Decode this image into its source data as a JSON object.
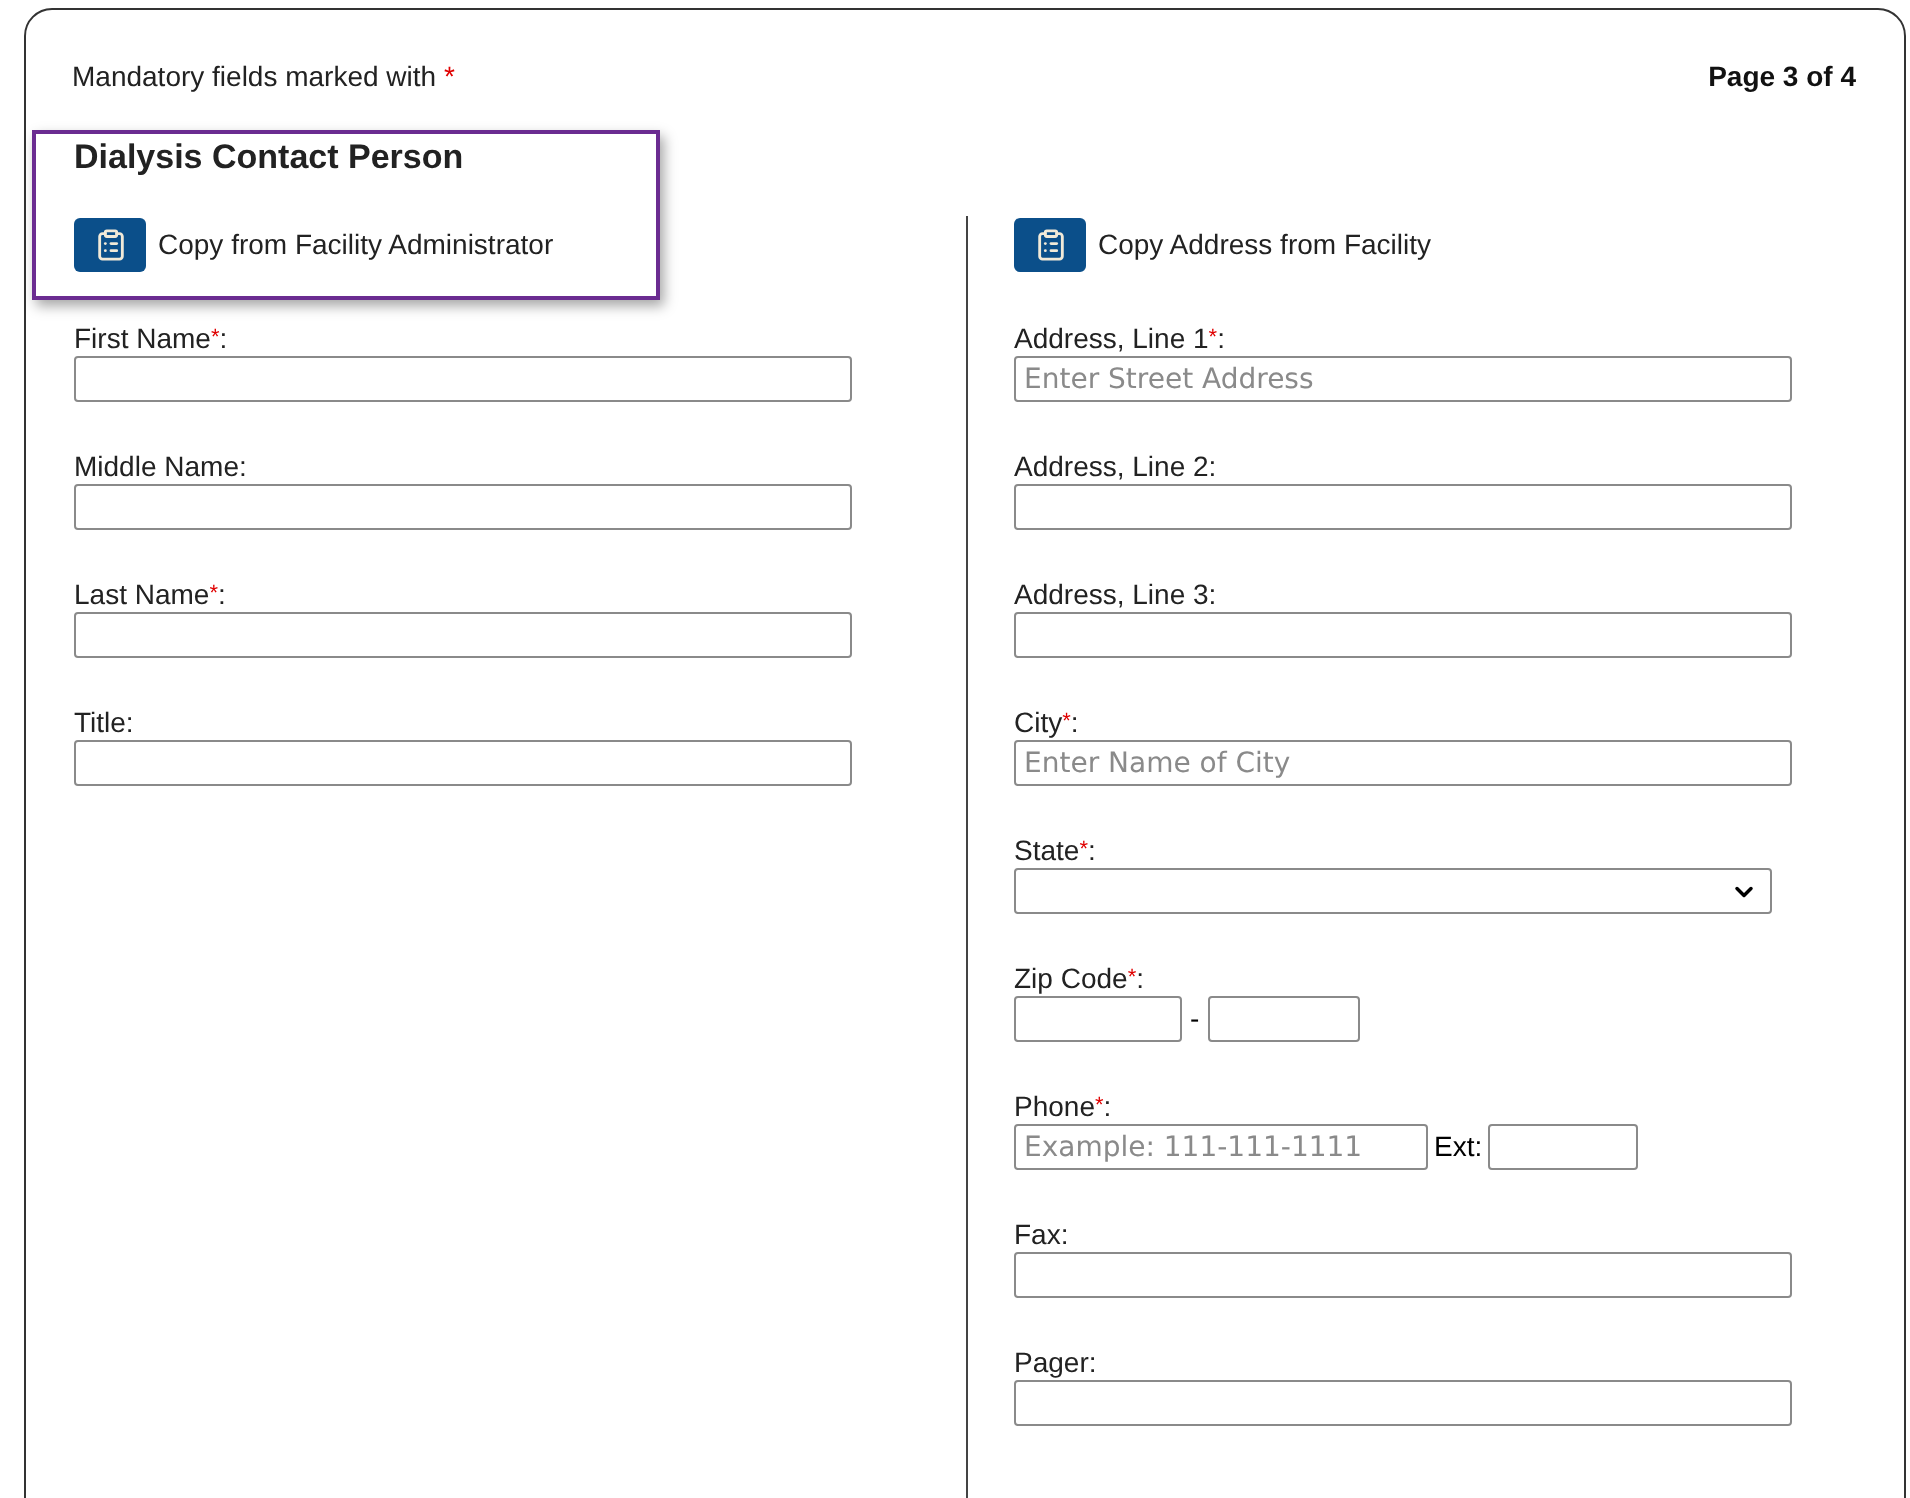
{
  "header": {
    "mandatory_note": "Mandatory fields marked with",
    "mandatory_mark": "*",
    "page_indicator": "Page 3 of 4"
  },
  "left": {
    "title": "Dialysis Contact Person",
    "highlighted": true,
    "copy_button": "Copy from Facility Administrator",
    "fields": [
      {
        "kind": "text",
        "label": "First Name",
        "asterisk": "*",
        "suffix": ":"
      },
      {
        "kind": "text",
        "label": "Middle Name:"
      },
      {
        "kind": "text",
        "label": "Last Name",
        "asterisk": "*",
        "suffix": ":"
      },
      {
        "kind": "text",
        "label": "Title:"
      }
    ]
  },
  "right": {
    "copy_button": "Copy Address from Facility",
    "fields": [
      {
        "kind": "text",
        "label": "Address, Line 1",
        "asterisk": "*",
        "suffix": ":",
        "placeholder": "Enter Street Address"
      },
      {
        "kind": "text",
        "label": "Address, Line 2:"
      },
      {
        "kind": "text",
        "label": "Address, Line 3:"
      },
      {
        "kind": "text",
        "label": "City",
        "asterisk": "*",
        "suffix": ":",
        "placeholder": "Enter Name of City"
      },
      {
        "kind": "select",
        "label": "State",
        "asterisk": "*",
        "suffix": ":"
      },
      {
        "kind": "zip",
        "label": "Zip Code",
        "asterisk": "*",
        "suffix": ":",
        "separator": "-"
      },
      {
        "kind": "phone",
        "label": "Phone",
        "asterisk": "*",
        "suffix": ":",
        "placeholder": "Example: 111-111-1111",
        "ext_label": "Ext:"
      },
      {
        "kind": "text",
        "label": "Fax:"
      },
      {
        "kind": "text",
        "label": "Pager:"
      }
    ]
  }
}
